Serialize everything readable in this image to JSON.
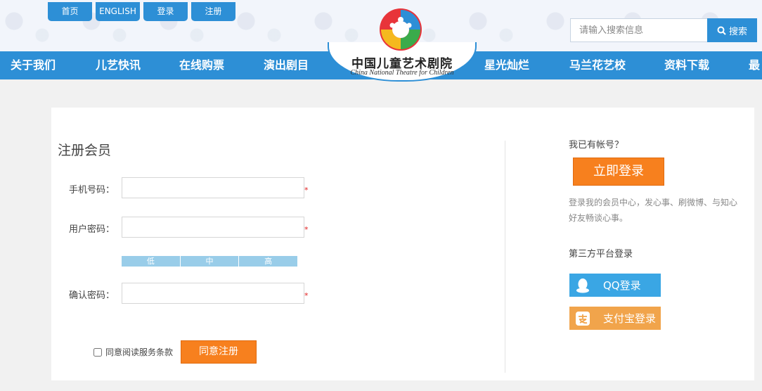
{
  "header": {
    "top_links": [
      "首页",
      "ENGLISH",
      "登录",
      "注册"
    ],
    "search": {
      "placeholder": "请输入搜索信息",
      "button_label": "搜索"
    },
    "logo": {
      "cn": "中国儿童艺术剧院",
      "en": "China National Theatre for Children"
    },
    "nav": [
      "关于我们",
      "儿艺快讯",
      "在线购票",
      "演出剧目",
      "星光灿烂",
      "马兰花艺校",
      "资料下载",
      "最"
    ]
  },
  "register": {
    "title": "注册会员",
    "fields": [
      {
        "label": "手机号码：",
        "value": "",
        "required": "*"
      },
      {
        "label": "用户密码：",
        "value": "",
        "required": "*"
      },
      {
        "label": "确认密码：",
        "value": "",
        "required": "*"
      }
    ],
    "strength": [
      "低",
      "中",
      "高"
    ],
    "agree_text": "同意阅读服务条款",
    "submit_label": "同意注册"
  },
  "login_side": {
    "have_account": "我已有帐号？",
    "login_button": "立即登录",
    "description": "登录我的会员中心，发心事、刷微博、与知心好友畅谈心事。",
    "third_party_title": "第三方平台登录",
    "qq_label": "QQ登录",
    "alipay_label": "支付宝登录"
  },
  "colors": {
    "brand_blue": "#2d8fd6",
    "accent_orange": "#f7801e",
    "qq_blue": "#3aa6e4",
    "alipay_orange": "#f1a44b"
  }
}
